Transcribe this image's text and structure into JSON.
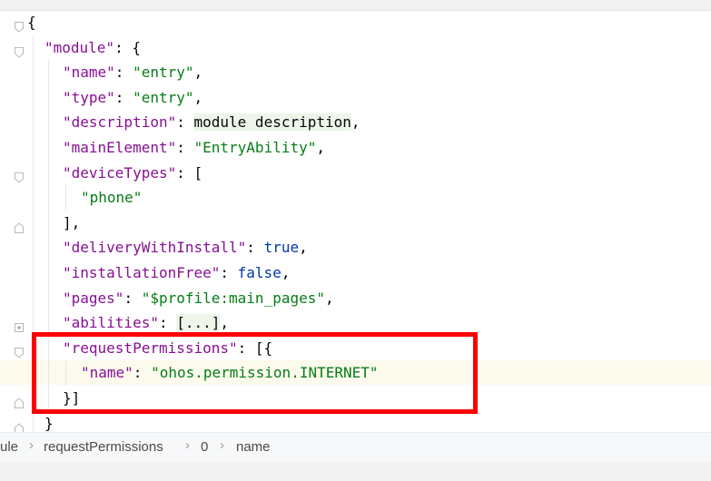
{
  "editor": {
    "lines": [
      {
        "id": "l1",
        "parts": [
          {
            "t": "{",
            "c": "punct"
          }
        ]
      },
      {
        "id": "l2",
        "parts": [
          {
            "t": "\"module\"",
            "c": "key"
          },
          {
            "t": ": {",
            "c": "punct"
          }
        ]
      },
      {
        "id": "l3",
        "parts": [
          {
            "t": "\"name\"",
            "c": "key"
          },
          {
            "t": ": ",
            "c": "punct"
          },
          {
            "t": "\"entry\"",
            "c": "str"
          },
          {
            "t": ",",
            "c": "punct"
          }
        ]
      },
      {
        "id": "l4",
        "parts": [
          {
            "t": "\"type\"",
            "c": "key"
          },
          {
            "t": ": ",
            "c": "punct"
          },
          {
            "t": "\"entry\"",
            "c": "str"
          },
          {
            "t": ",",
            "c": "punct"
          }
        ]
      },
      {
        "id": "l5",
        "parts": [
          {
            "t": "\"description\"",
            "c": "key"
          },
          {
            "t": ": ",
            "c": "punct"
          },
          {
            "t": "module description",
            "c": "punct hl"
          },
          {
            "t": ",",
            "c": "punct"
          }
        ]
      },
      {
        "id": "l6",
        "parts": [
          {
            "t": "\"mainElement\"",
            "c": "key"
          },
          {
            "t": ": ",
            "c": "punct"
          },
          {
            "t": "\"EntryAbility\"",
            "c": "str"
          },
          {
            "t": ",",
            "c": "punct"
          }
        ]
      },
      {
        "id": "l7",
        "parts": [
          {
            "t": "\"deviceTypes\"",
            "c": "key"
          },
          {
            "t": ": [",
            "c": "punct"
          }
        ]
      },
      {
        "id": "l8",
        "parts": [
          {
            "t": "\"phone\"",
            "c": "str"
          }
        ]
      },
      {
        "id": "l9",
        "parts": [
          {
            "t": "],",
            "c": "punct"
          }
        ]
      },
      {
        "id": "l10",
        "parts": [
          {
            "t": "\"deliveryWithInstall\"",
            "c": "key"
          },
          {
            "t": ": ",
            "c": "punct"
          },
          {
            "t": "true",
            "c": "kw"
          },
          {
            "t": ",",
            "c": "punct"
          }
        ]
      },
      {
        "id": "l11",
        "parts": [
          {
            "t": "\"installationFree\"",
            "c": "key"
          },
          {
            "t": ": ",
            "c": "punct"
          },
          {
            "t": "false",
            "c": "kw"
          },
          {
            "t": ",",
            "c": "punct"
          }
        ]
      },
      {
        "id": "l12",
        "parts": [
          {
            "t": "\"pages\"",
            "c": "key"
          },
          {
            "t": ": ",
            "c": "punct"
          },
          {
            "t": "\"$profile:main_pages\"",
            "c": "str"
          },
          {
            "t": ",",
            "c": "punct"
          }
        ]
      },
      {
        "id": "l13",
        "parts": [
          {
            "t": "\"abilities\"",
            "c": "key"
          },
          {
            "t": ": ",
            "c": "punct"
          },
          {
            "t": "[...]",
            "c": "punct hl"
          },
          {
            "t": ",",
            "c": "punct"
          }
        ]
      },
      {
        "id": "l14",
        "parts": [
          {
            "t": "\"requestPermissions\"",
            "c": "key"
          },
          {
            "t": ": [{",
            "c": "punct"
          }
        ]
      },
      {
        "id": "l15",
        "parts": [
          {
            "t": "\"name\"",
            "c": "key"
          },
          {
            "t": ": ",
            "c": "punct"
          },
          {
            "t": "\"ohos.permission.INTERNET\"",
            "c": "str"
          }
        ]
      },
      {
        "id": "l16",
        "parts": [
          {
            "t": "}]",
            "c": "punct"
          }
        ]
      },
      {
        "id": "l17",
        "parts": [
          {
            "t": "}",
            "c": "punct"
          }
        ]
      }
    ]
  },
  "breadcrumb": {
    "items": [
      "ule",
      "requestPermissions",
      "0",
      "name"
    ],
    "separator": "›"
  },
  "colors": {
    "key": "#871094",
    "string": "#067d17",
    "keyword": "#0033b3",
    "highlight_box": "#ff0000",
    "current_line": "#fcfaed"
  },
  "icons": {
    "fold_open": "fold-open-icon",
    "fold_closed": "fold-closed-icon",
    "fold_end": "fold-end-icon"
  }
}
